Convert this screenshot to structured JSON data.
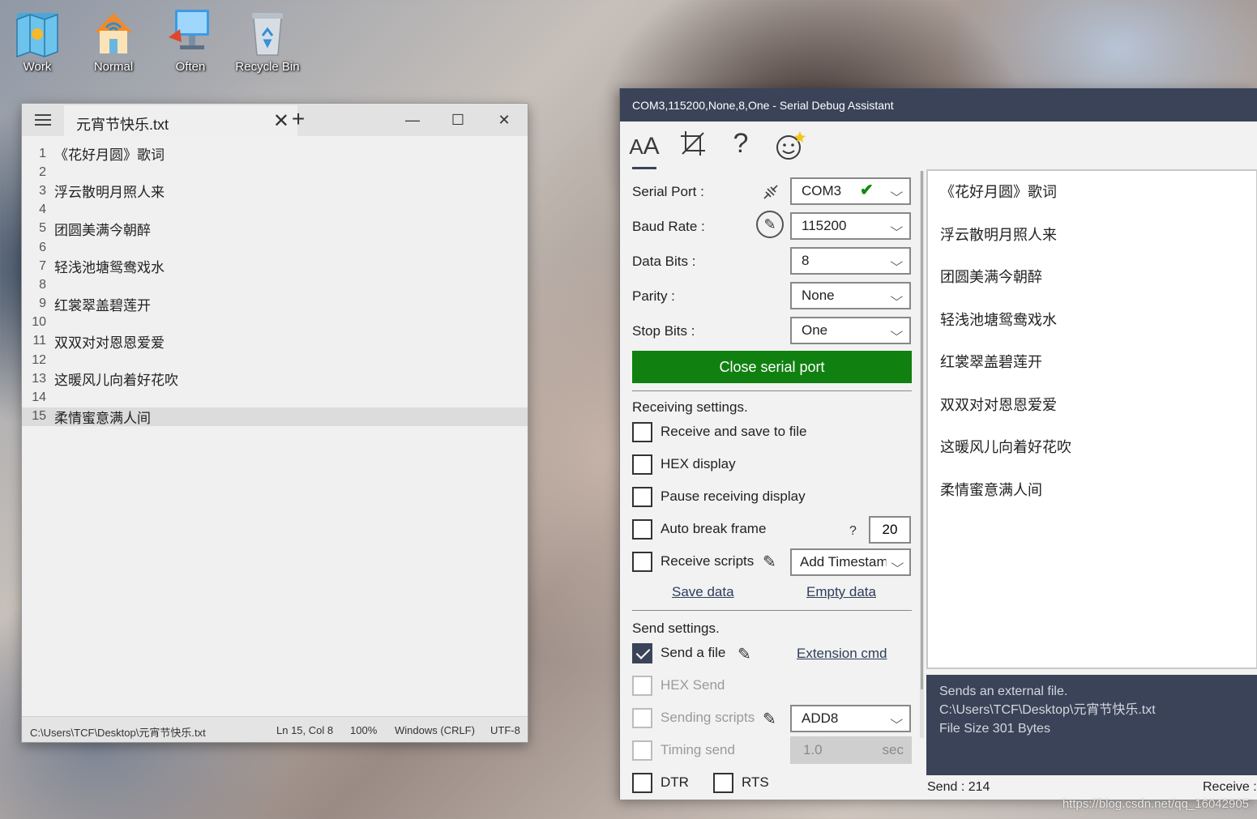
{
  "desktop": {
    "icons": [
      {
        "label": "Work",
        "icon": "folder-map-icon"
      },
      {
        "label": "Normal",
        "icon": "home-wifi-icon"
      },
      {
        "label": "Often",
        "icon": "computer-icon"
      },
      {
        "label": "Recycle Bin",
        "icon": "recycle-bin-icon"
      }
    ],
    "watermark": "https://blog.csdn.net/qq_16042905"
  },
  "notepad": {
    "tab_title": "元宵节快乐.txt",
    "lines": [
      {
        "num": "1",
        "text": "《花好月圆》歌词"
      },
      {
        "num": "2",
        "text": ""
      },
      {
        "num": "3",
        "text": "浮云散明月照人来"
      },
      {
        "num": "4",
        "text": ""
      },
      {
        "num": "5",
        "text": "团圆美满今朝醉"
      },
      {
        "num": "6",
        "text": ""
      },
      {
        "num": "7",
        "text": "轻浅池塘鸳鸯戏水"
      },
      {
        "num": "8",
        "text": ""
      },
      {
        "num": "9",
        "text": "红裳翠盖碧莲开"
      },
      {
        "num": "10",
        "text": ""
      },
      {
        "num": "11",
        "text": "双双对对恩恩爱爱"
      },
      {
        "num": "12",
        "text": ""
      },
      {
        "num": "13",
        "text": "这暖风儿向着好花吹"
      },
      {
        "num": "14",
        "text": ""
      },
      {
        "num": "15",
        "text": "柔情蜜意满人间"
      }
    ],
    "status": {
      "path": "C:\\Users\\TCF\\Desktop\\元宵节快乐.txt",
      "position": "Ln 15, Col 8",
      "zoom": "100%",
      "eol": "Windows (CRLF)",
      "encoding": "UTF-8"
    }
  },
  "serial": {
    "title": "COM3,115200,None,8,One - Serial Debug Assistant",
    "toolbar": [
      "font-size-icon",
      "crop-icon",
      "help-icon",
      "emoji-icon"
    ],
    "port": {
      "serial_port_label": "Serial Port :",
      "serial_port_value": "COM3",
      "baud_label": "Baud Rate :",
      "baud_value": "115200",
      "data_bits_label": "Data Bits :",
      "data_bits_value": "8",
      "parity_label": "Parity :",
      "parity_value": "None",
      "stop_bits_label": "Stop Bits :",
      "stop_bits_value": "One",
      "close_button": "Close serial port"
    },
    "receiving": {
      "heading": "Receiving settings.",
      "save_to_file": "Receive and save to file",
      "hex_display": "HEX display",
      "pause_display": "Pause receiving display",
      "auto_break": "Auto break frame",
      "auto_break_help": "?",
      "auto_break_value": "20",
      "receive_scripts": "Receive scripts",
      "receive_scripts_value": "Add Timestamp",
      "save_data": "Save data",
      "empty_data": "Empty data"
    },
    "send": {
      "heading": "Send settings.",
      "send_file": "Send a file",
      "extension_cmd": "Extension cmd",
      "hex_send": "HEX Send",
      "sending_scripts": "Sending scripts",
      "sending_scripts_value": "ADD8",
      "timing_send": "Timing send",
      "timing_value": "1.0",
      "timing_unit": "sec",
      "dtr": "DTR",
      "rts": "RTS"
    },
    "received_lines": [
      "《花好月圆》歌词",
      "浮云散明月照人来",
      "团圆美满今朝醉",
      "轻浅池塘鸳鸯戏水",
      "红裳翠盖碧莲开",
      "双双对对恩恩爱爱",
      "这暖风儿向着好花吹",
      "柔情蜜意满人间"
    ],
    "info": {
      "line1": "Sends an external file.",
      "line2": "C:\\Users\\TCF\\Desktop\\元宵节快乐.txt",
      "line3": "File Size 301 Bytes"
    },
    "stats": {
      "send": "Send : 214",
      "receive": "Receive :"
    }
  }
}
